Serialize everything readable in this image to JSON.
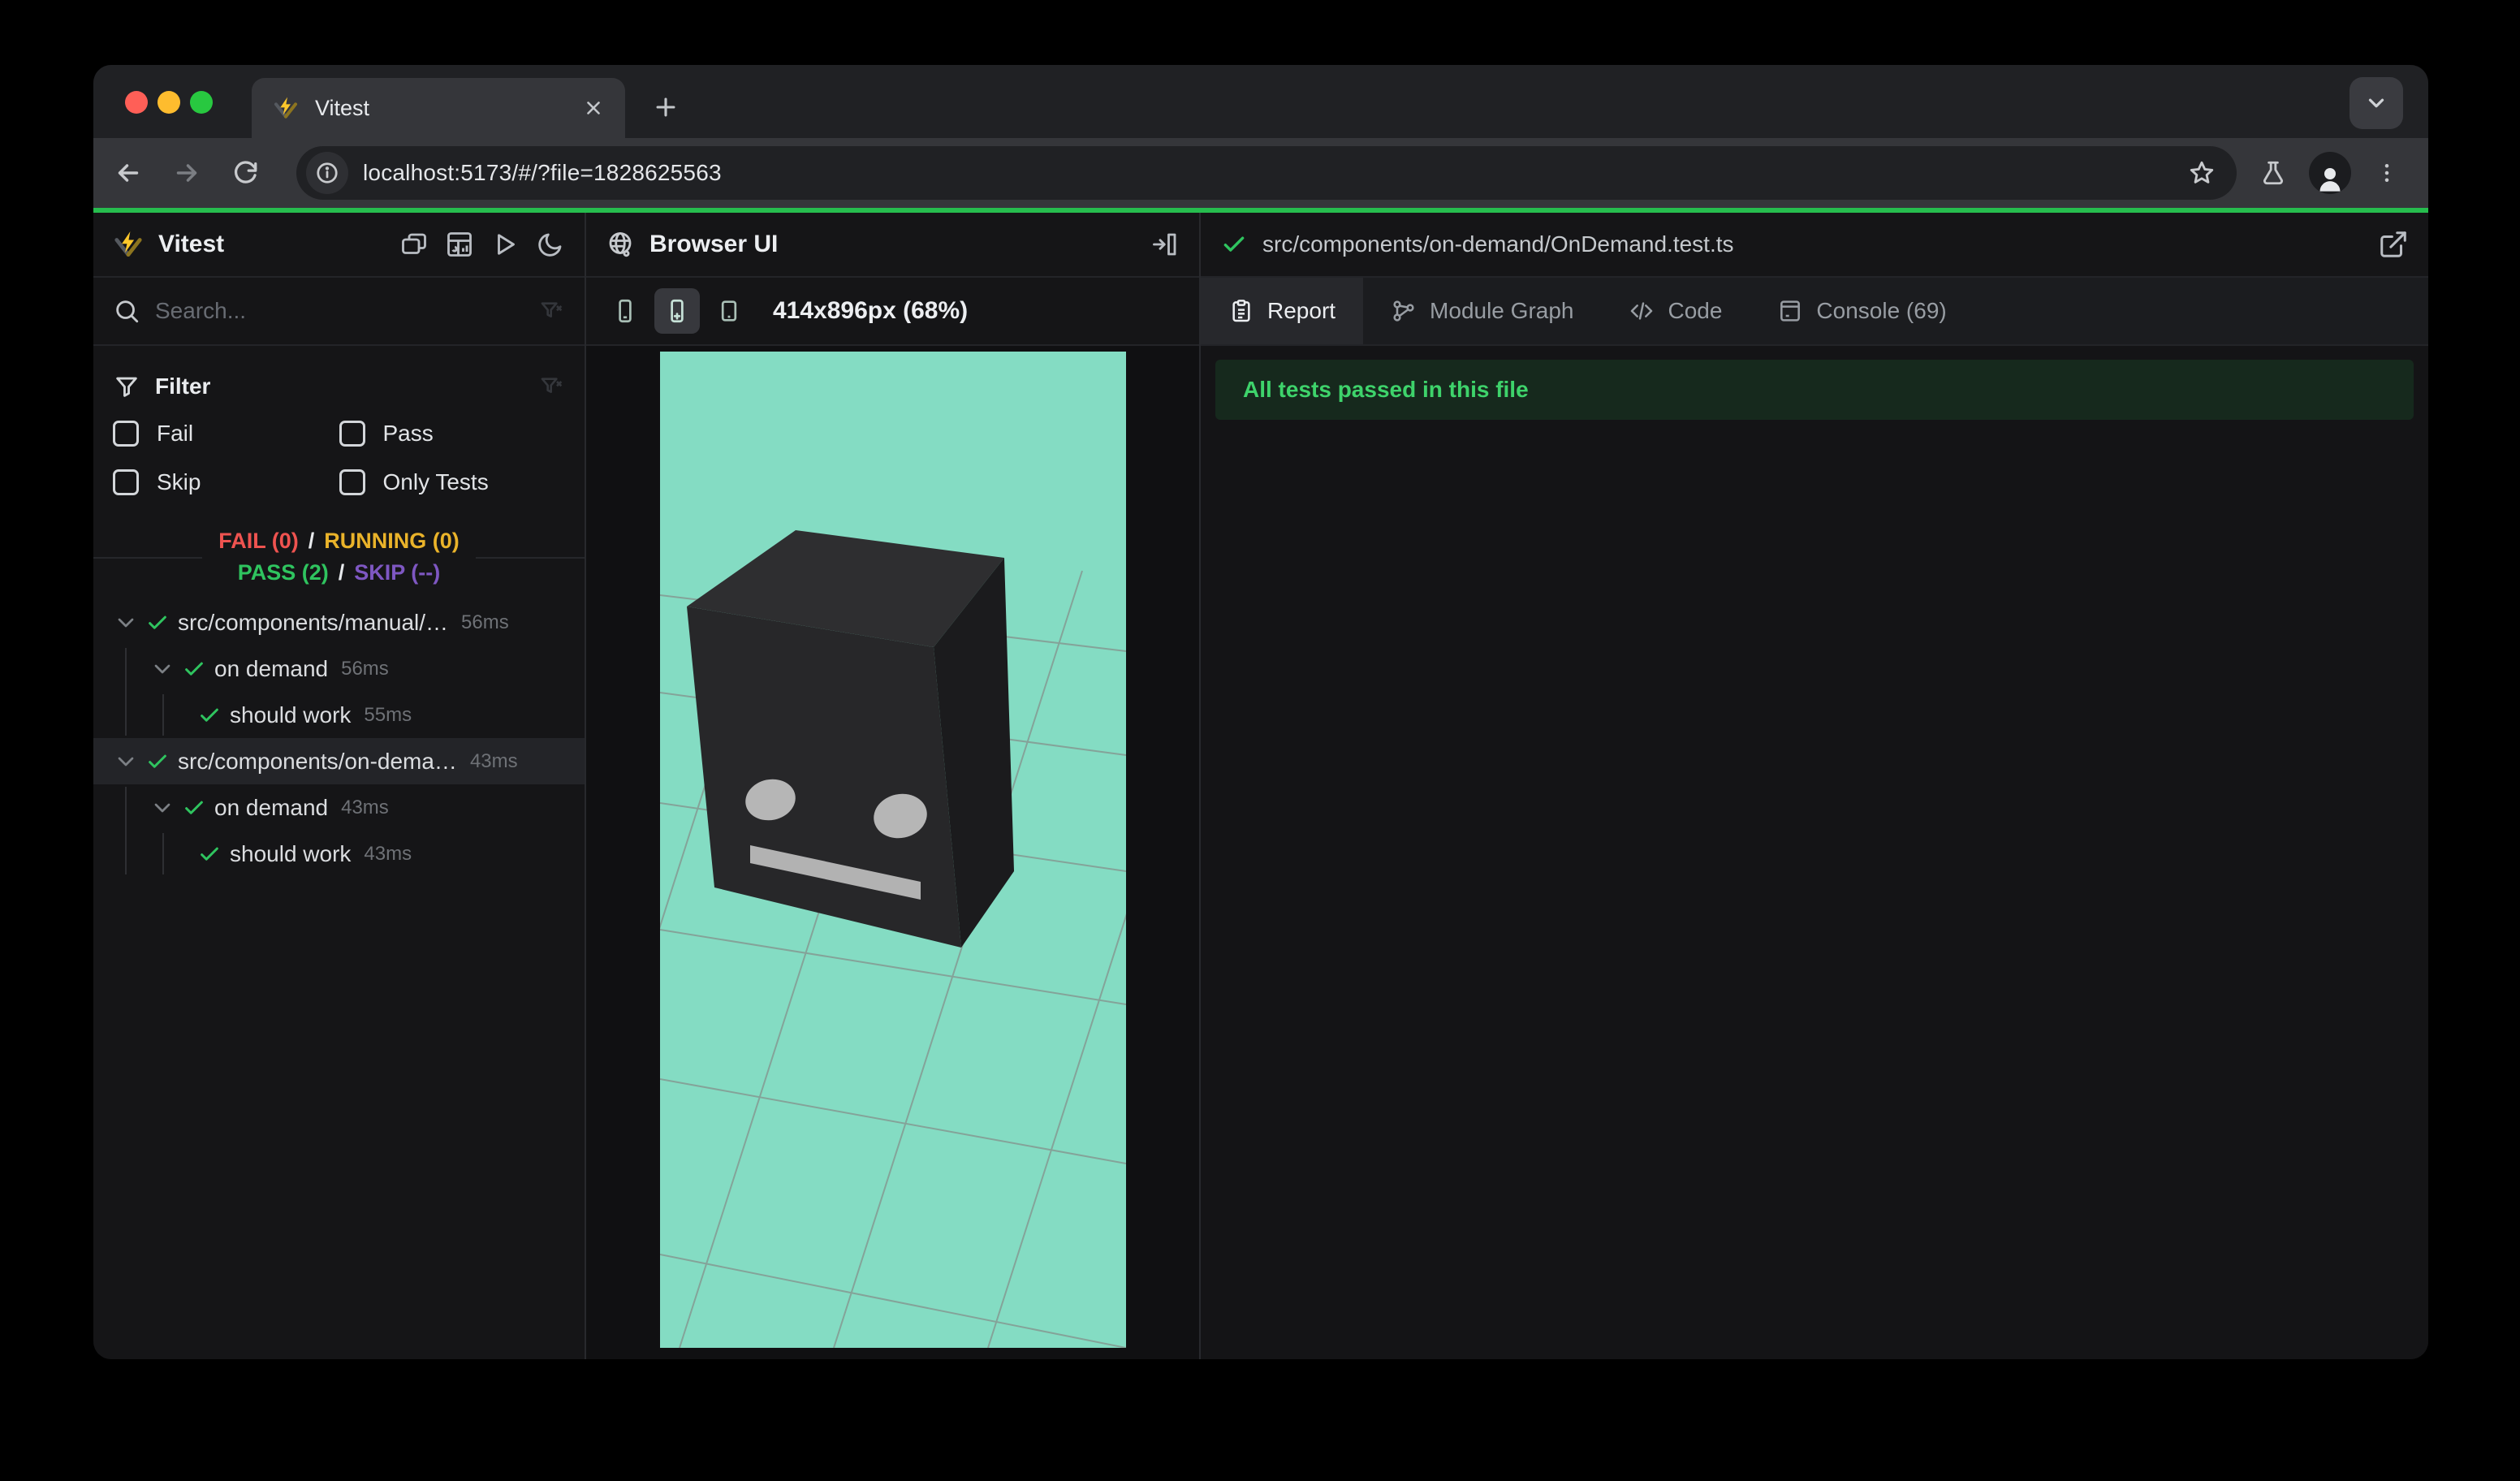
{
  "browser": {
    "tab_title": "Vitest",
    "url": "localhost:5173/#/?file=1828625563"
  },
  "sidebar": {
    "title": "Vitest",
    "search_placeholder": "Search...",
    "filter": {
      "title": "Filter",
      "options": [
        "Fail",
        "Pass",
        "Skip",
        "Only Tests"
      ]
    },
    "status": {
      "fail": "FAIL (0)",
      "running": "RUNNING (0)",
      "pass": "PASS (2)",
      "skip": "SKIP (--)",
      "separator": "/"
    },
    "tree": [
      {
        "label": "src/components/manual/…",
        "time": "56ms"
      },
      {
        "label": "on demand",
        "time": "56ms"
      },
      {
        "label": "should work",
        "time": "55ms"
      },
      {
        "label": "src/components/on-dema…",
        "time": "43ms"
      },
      {
        "label": "on demand",
        "time": "43ms"
      },
      {
        "label": "should work",
        "time": "43ms"
      }
    ]
  },
  "browser_panel": {
    "title": "Browser UI",
    "viewport_label": "414x896px (68%)"
  },
  "report_panel": {
    "file_path": "src/components/on-demand/OnDemand.test.ts",
    "tabs": [
      {
        "label": "Report"
      },
      {
        "label": "Module Graph"
      },
      {
        "label": "Code"
      },
      {
        "label": "Console (69)"
      }
    ],
    "banner": "All tests passed in this file"
  },
  "colors": {
    "progress_green": "#26bd4e",
    "pass_green": "#2fc45f",
    "fail_red": "#ef5350",
    "running_amber": "#eab32a",
    "skip_purple": "#7e57c2",
    "banner_bg": "#16291d",
    "banner_text": "#3ed36b",
    "canvas_teal": "#84dcc3"
  }
}
